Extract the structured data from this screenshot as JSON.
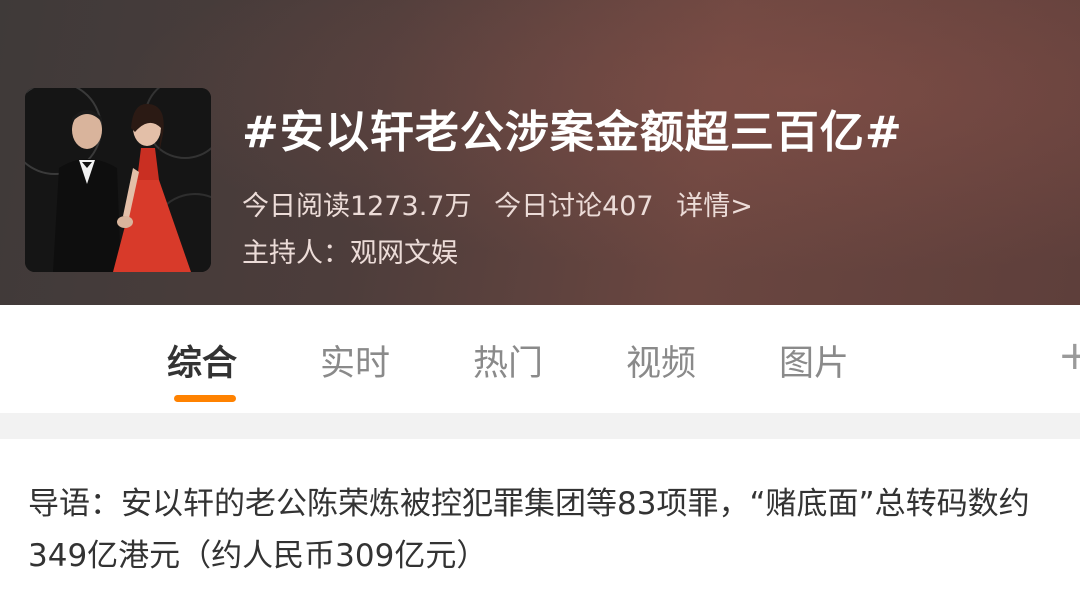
{
  "topic": {
    "title": "#安以轩老公涉案金额超三百亿#",
    "reads": "今日阅读1273.7万",
    "discussions": "今日讨论407",
    "details_link": "详情>",
    "host": "主持人：观网文娱"
  },
  "tabs": [
    {
      "label": "综合",
      "active": true
    },
    {
      "label": "实时",
      "active": false
    },
    {
      "label": "热门",
      "active": false
    },
    {
      "label": "视频",
      "active": false
    },
    {
      "label": "图片",
      "active": false
    }
  ],
  "tab_more_icon": "plus-icon",
  "intro": "导语：安以轩的老公陈荣炼被控犯罪集团等83项罪，“赌底面”总转码数约349亿港元（约人民币309亿元）",
  "colors": {
    "accent": "#ff8200",
    "header_bg": "#4d3d3b",
    "active_tab": "#333333",
    "inactive_tab": "#8a8a8a"
  }
}
